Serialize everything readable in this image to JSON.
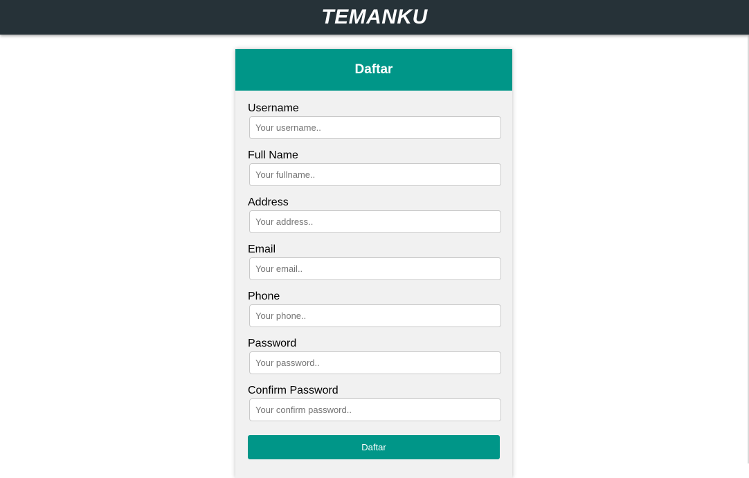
{
  "app": {
    "brand": "TEMANKU"
  },
  "form": {
    "title": "Daftar",
    "fields": [
      {
        "label": "Username",
        "placeholder": "Your username.."
      },
      {
        "label": "Full Name",
        "placeholder": "Your fullname.."
      },
      {
        "label": "Address",
        "placeholder": "Your address.."
      },
      {
        "label": "Email",
        "placeholder": "Your email.."
      },
      {
        "label": "Phone",
        "placeholder": "Your phone.."
      },
      {
        "label": "Password",
        "placeholder": "Your password.."
      },
      {
        "label": "Confirm Password",
        "placeholder": "Your confirm password.."
      }
    ],
    "submit_label": "Daftar"
  },
  "colors": {
    "topbar": "#263238",
    "accent": "#009688",
    "card_background": "#f1f1f1"
  }
}
